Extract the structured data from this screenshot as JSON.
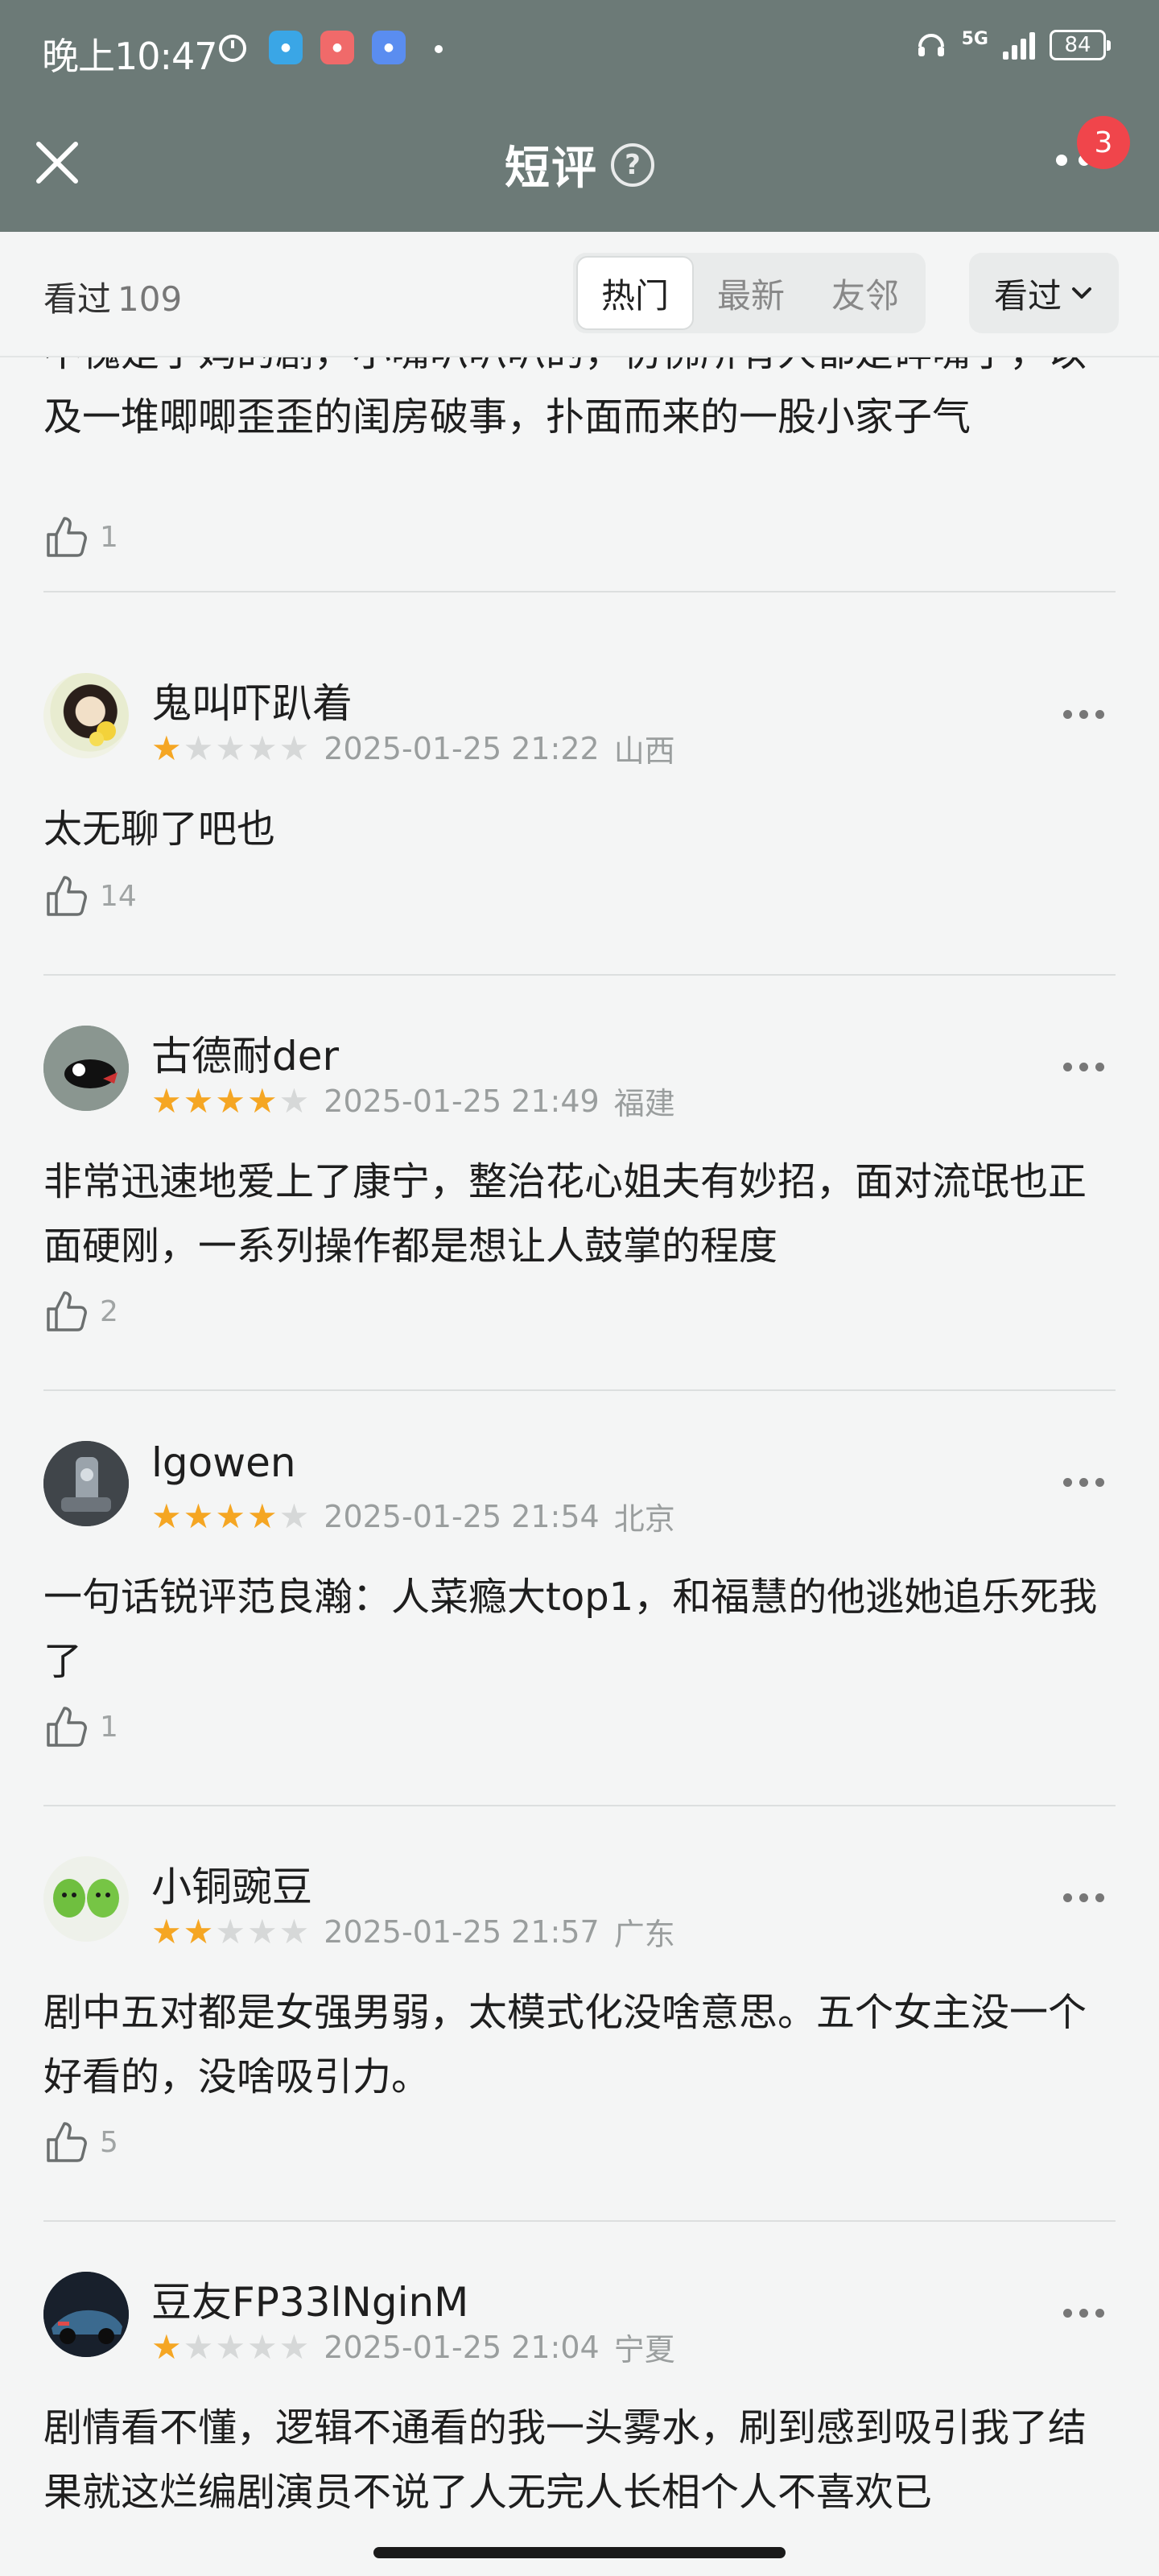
{
  "status_bar": {
    "time": "晚上10:47",
    "network": "5G",
    "battery": "84"
  },
  "header": {
    "title": "短评",
    "help_icon": "?",
    "badge_count": "3"
  },
  "filter": {
    "seen_label": "看过",
    "seen_count": "109",
    "tabs": [
      "热门",
      "最新",
      "友邻"
    ],
    "active_tab": "热门",
    "dropdown_label": "看过"
  },
  "colors": {
    "header_bg": "#6c7a77",
    "star_on": "#f5a623",
    "star_off": "#d6d8d8",
    "badge": "#f0454b"
  },
  "partial_review": {
    "text": "不愧是于妈的剧，小嘴叭叭叭的，仿佛所有人都是碎嘴子，以及一堆唧唧歪歪的闺房破事，扑面而来的一股小家子气",
    "likes": "1"
  },
  "reviews": [
    {
      "user": "鬼叫吓趴着",
      "stars": 1,
      "date": "2025-01-25 21:22",
      "location": "山西",
      "text": "太无聊了吧也",
      "likes": "14"
    },
    {
      "user": "古德耐der",
      "stars": 4,
      "date": "2025-01-25 21:49",
      "location": "福建",
      "text": "非常迅速地爱上了康宁，整治花心姐夫有妙招，面对流氓也正面硬刚，一系列操作都是想让人鼓掌的程度",
      "likes": "2"
    },
    {
      "user": "lgowen",
      "stars": 4,
      "date": "2025-01-25 21:54",
      "location": "北京",
      "text": "一句话锐评范良瀚：人菜瘾大top1，和福慧的他逃她追乐死我了",
      "likes": "1"
    },
    {
      "user": "小铜豌豆",
      "stars": 2,
      "date": "2025-01-25 21:57",
      "location": "广东",
      "text": "剧中五对都是女强男弱，太模式化没啥意思。五个女主没一个好看的，没啥吸引力。",
      "likes": "5"
    },
    {
      "user": "豆友FP33lNginM",
      "stars": 1,
      "date": "2025-01-25 21:04",
      "location": "宁夏",
      "text": "剧情看不懂，逻辑不通看的我一头雾水，刷到感到吸引我了结果就这烂编剧演员不说了人无完人长相个人不喜欢已",
      "likes": ""
    }
  ]
}
